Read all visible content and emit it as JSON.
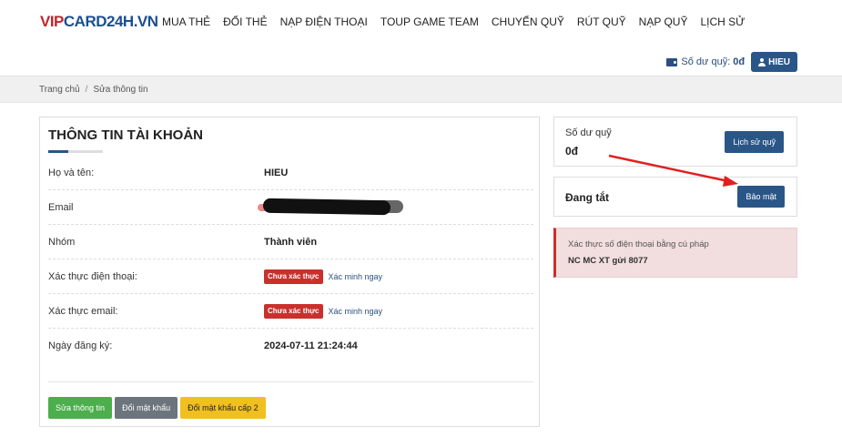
{
  "logo": {
    "part1": "VIP",
    "part2": "CARD24H.VN"
  },
  "nav": [
    {
      "label": "MUA THẺ"
    },
    {
      "label": "ĐỔI THẺ"
    },
    {
      "label": "NẠP ĐIỆN THOẠI"
    },
    {
      "label": "TOUP GAME TEAM"
    },
    {
      "label": "CHUYỂN QUỸ"
    },
    {
      "label": "RÚT QUỸ"
    },
    {
      "label": "NẠP QUỸ"
    },
    {
      "label": "LỊCH SỬ"
    }
  ],
  "header": {
    "balance_label": "Số dư quỹ:",
    "balance_value": "0đ",
    "user_label": "HIEU"
  },
  "breadcrumb": {
    "home": "Trang chủ",
    "sep": "/",
    "current": "Sửa thông tin"
  },
  "account": {
    "title": "THÔNG TIN TÀI KHOẢN",
    "rows": [
      {
        "label": "Họ và tên:",
        "value": "HIEU"
      },
      {
        "label": "Email",
        "value": ""
      },
      {
        "label": "Nhóm",
        "value": "Thành viên"
      },
      {
        "label": "Xác thực điện thoại:",
        "badge": "Chưa xác thực",
        "link": "Xác minh ngay"
      },
      {
        "label": "Xác thực email:",
        "badge": "Chưa xác thực",
        "link": "Xác minh ngay"
      },
      {
        "label": "Ngày đăng ký:",
        "value": "2024-07-11 21:24:44"
      }
    ],
    "buttons": {
      "edit": "Sửa thông tin",
      "change_password": "Đổi mật khẩu",
      "change_password_2": "Đổi mật khẩu cấp 2"
    }
  },
  "sidebar": {
    "fund_label": "Số dư quỹ",
    "fund_value": "0đ",
    "fund_history_button": "Lịch sử quỹ",
    "security_status": "Đang tắt",
    "security_button": "Bảo mật",
    "alert_line1": "Xác thực số điện thoại bằng cú pháp",
    "alert_line2": "NC MC XT gửi 8077"
  },
  "colors": {
    "primary": "#2a5687",
    "danger": "#c9302c",
    "success": "#4cae4c",
    "warning": "#f0c020",
    "annotation_arrow": "#e02020"
  }
}
